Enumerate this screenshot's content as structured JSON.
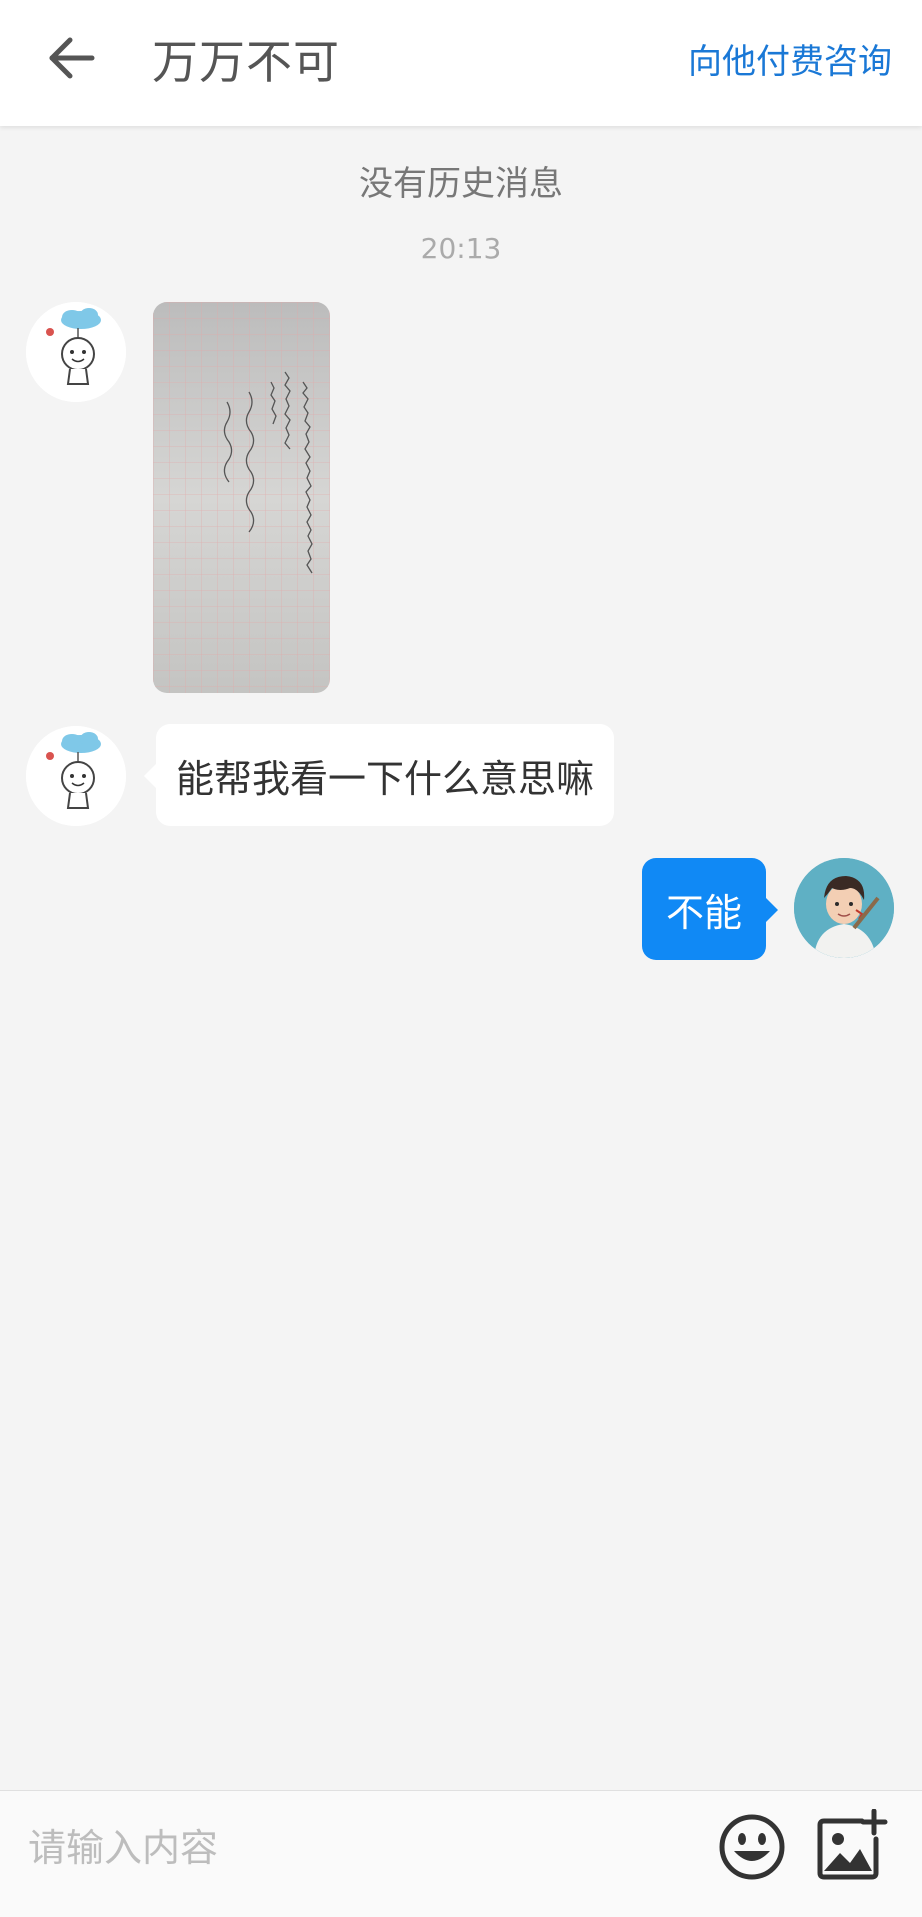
{
  "header": {
    "back_icon": "arrow-left-icon",
    "title": "万万不可",
    "action_label": "向他付费咨询",
    "accent_color": "#1a78d6"
  },
  "chat": {
    "no_history_text": "没有历史消息",
    "timestamp": "20:13",
    "messages": [
      {
        "side": "left",
        "type": "image",
        "image_desc": "photo of handwritten notebook page",
        "avatar_icon": "cartoon-cloud-avatar"
      },
      {
        "side": "left",
        "type": "text",
        "text": "能帮我看一下什么意思嘛",
        "avatar_icon": "cartoon-cloud-avatar"
      },
      {
        "side": "right",
        "type": "text",
        "text": "不能",
        "avatar_icon": "anime-character-avatar",
        "bubble_color": "#1089f5"
      }
    ]
  },
  "input_bar": {
    "placeholder": "请输入内容",
    "emoji_icon": "emoji-icon",
    "image_icon": "add-image-icon"
  }
}
